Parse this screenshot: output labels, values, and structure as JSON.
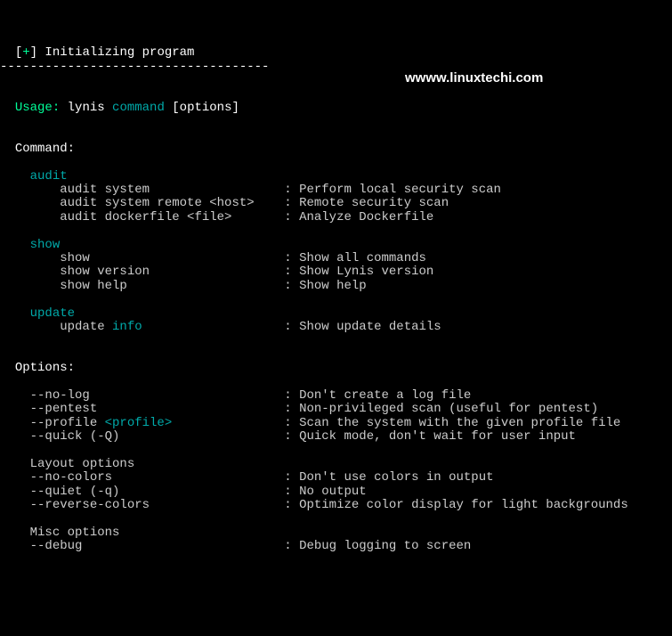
{
  "header": {
    "bracket_open": "[",
    "plus": "+",
    "bracket_close": "]",
    "title": " Initializing program",
    "rule": "------------------------------------"
  },
  "watermark": "wwww.linuxtechi.com",
  "usage": {
    "label": "Usage:",
    "prog": " lynis ",
    "cmd": "command",
    "opts": " [options]"
  },
  "command_header": "Command:",
  "audit": {
    "label": "audit",
    "sub1_cmd": "audit system",
    "sub1_desc": "Perform local security scan",
    "sub2_cmd": "audit system remote <host>",
    "sub2_desc": "Remote security scan",
    "sub3_cmd": "audit dockerfile <file>",
    "sub3_desc": "Analyze Dockerfile"
  },
  "show": {
    "label": "show",
    "sub1_cmd": "show",
    "sub1_desc": "Show all commands",
    "sub2_cmd": "show version",
    "sub2_desc": "Show Lynis version",
    "sub3_cmd": "show help",
    "sub3_desc": "Show help"
  },
  "update": {
    "label": "update",
    "sub1_cmd1": "update ",
    "sub1_cmd2": "info",
    "sub1_desc": "Show update details"
  },
  "options_header": "Options:",
  "opts": {
    "nolog_f": "--no-log",
    "nolog_d": "Don't create a log file",
    "pentest_f": "--pentest",
    "pentest_d": "Non-privileged scan (useful for pentest)",
    "profile_f1": "--profile ",
    "profile_f2": "<profile>",
    "profile_d": "Scan the system with the given profile file",
    "quick_f": "--quick (-Q)",
    "quick_d": "Quick mode, don't wait for user input",
    "layout_hdr": "Layout options",
    "nocolors_f": "--no-colors",
    "nocolors_d": "Don't use colors in output",
    "quiet_f": "--quiet (-q)",
    "quiet_d": "No output",
    "revcol_f": "--reverse-colors",
    "revcol_d": "Optimize color display for light backgrounds",
    "misc_hdr": "Misc options",
    "debug_f": "--debug",
    "debug_d": "Debug logging to screen"
  }
}
